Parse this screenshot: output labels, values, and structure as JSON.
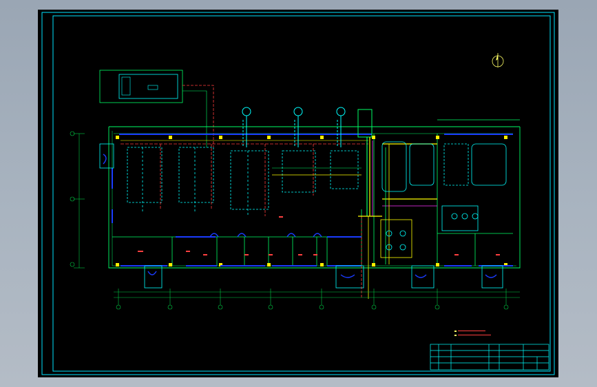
{
  "viewport": {
    "background": "#000000"
  },
  "colors": {
    "frame": "#00e5ff",
    "wall": "#00ff66",
    "column": "#ffee00",
    "window": "#1a3cff",
    "pipe_red": "#ff3b3b",
    "pipe_yellow": "#ffff00",
    "pipe_magenta": "#ff33ff",
    "equipment": "#00ffff",
    "grid": "#00cc44",
    "text": "#ff4040"
  },
  "icons": {
    "north_arrow": "north-arrow-icon"
  },
  "notes": {
    "line1": "",
    "line2": ""
  },
  "title_block": {
    "drawing_title": "",
    "labels": []
  }
}
